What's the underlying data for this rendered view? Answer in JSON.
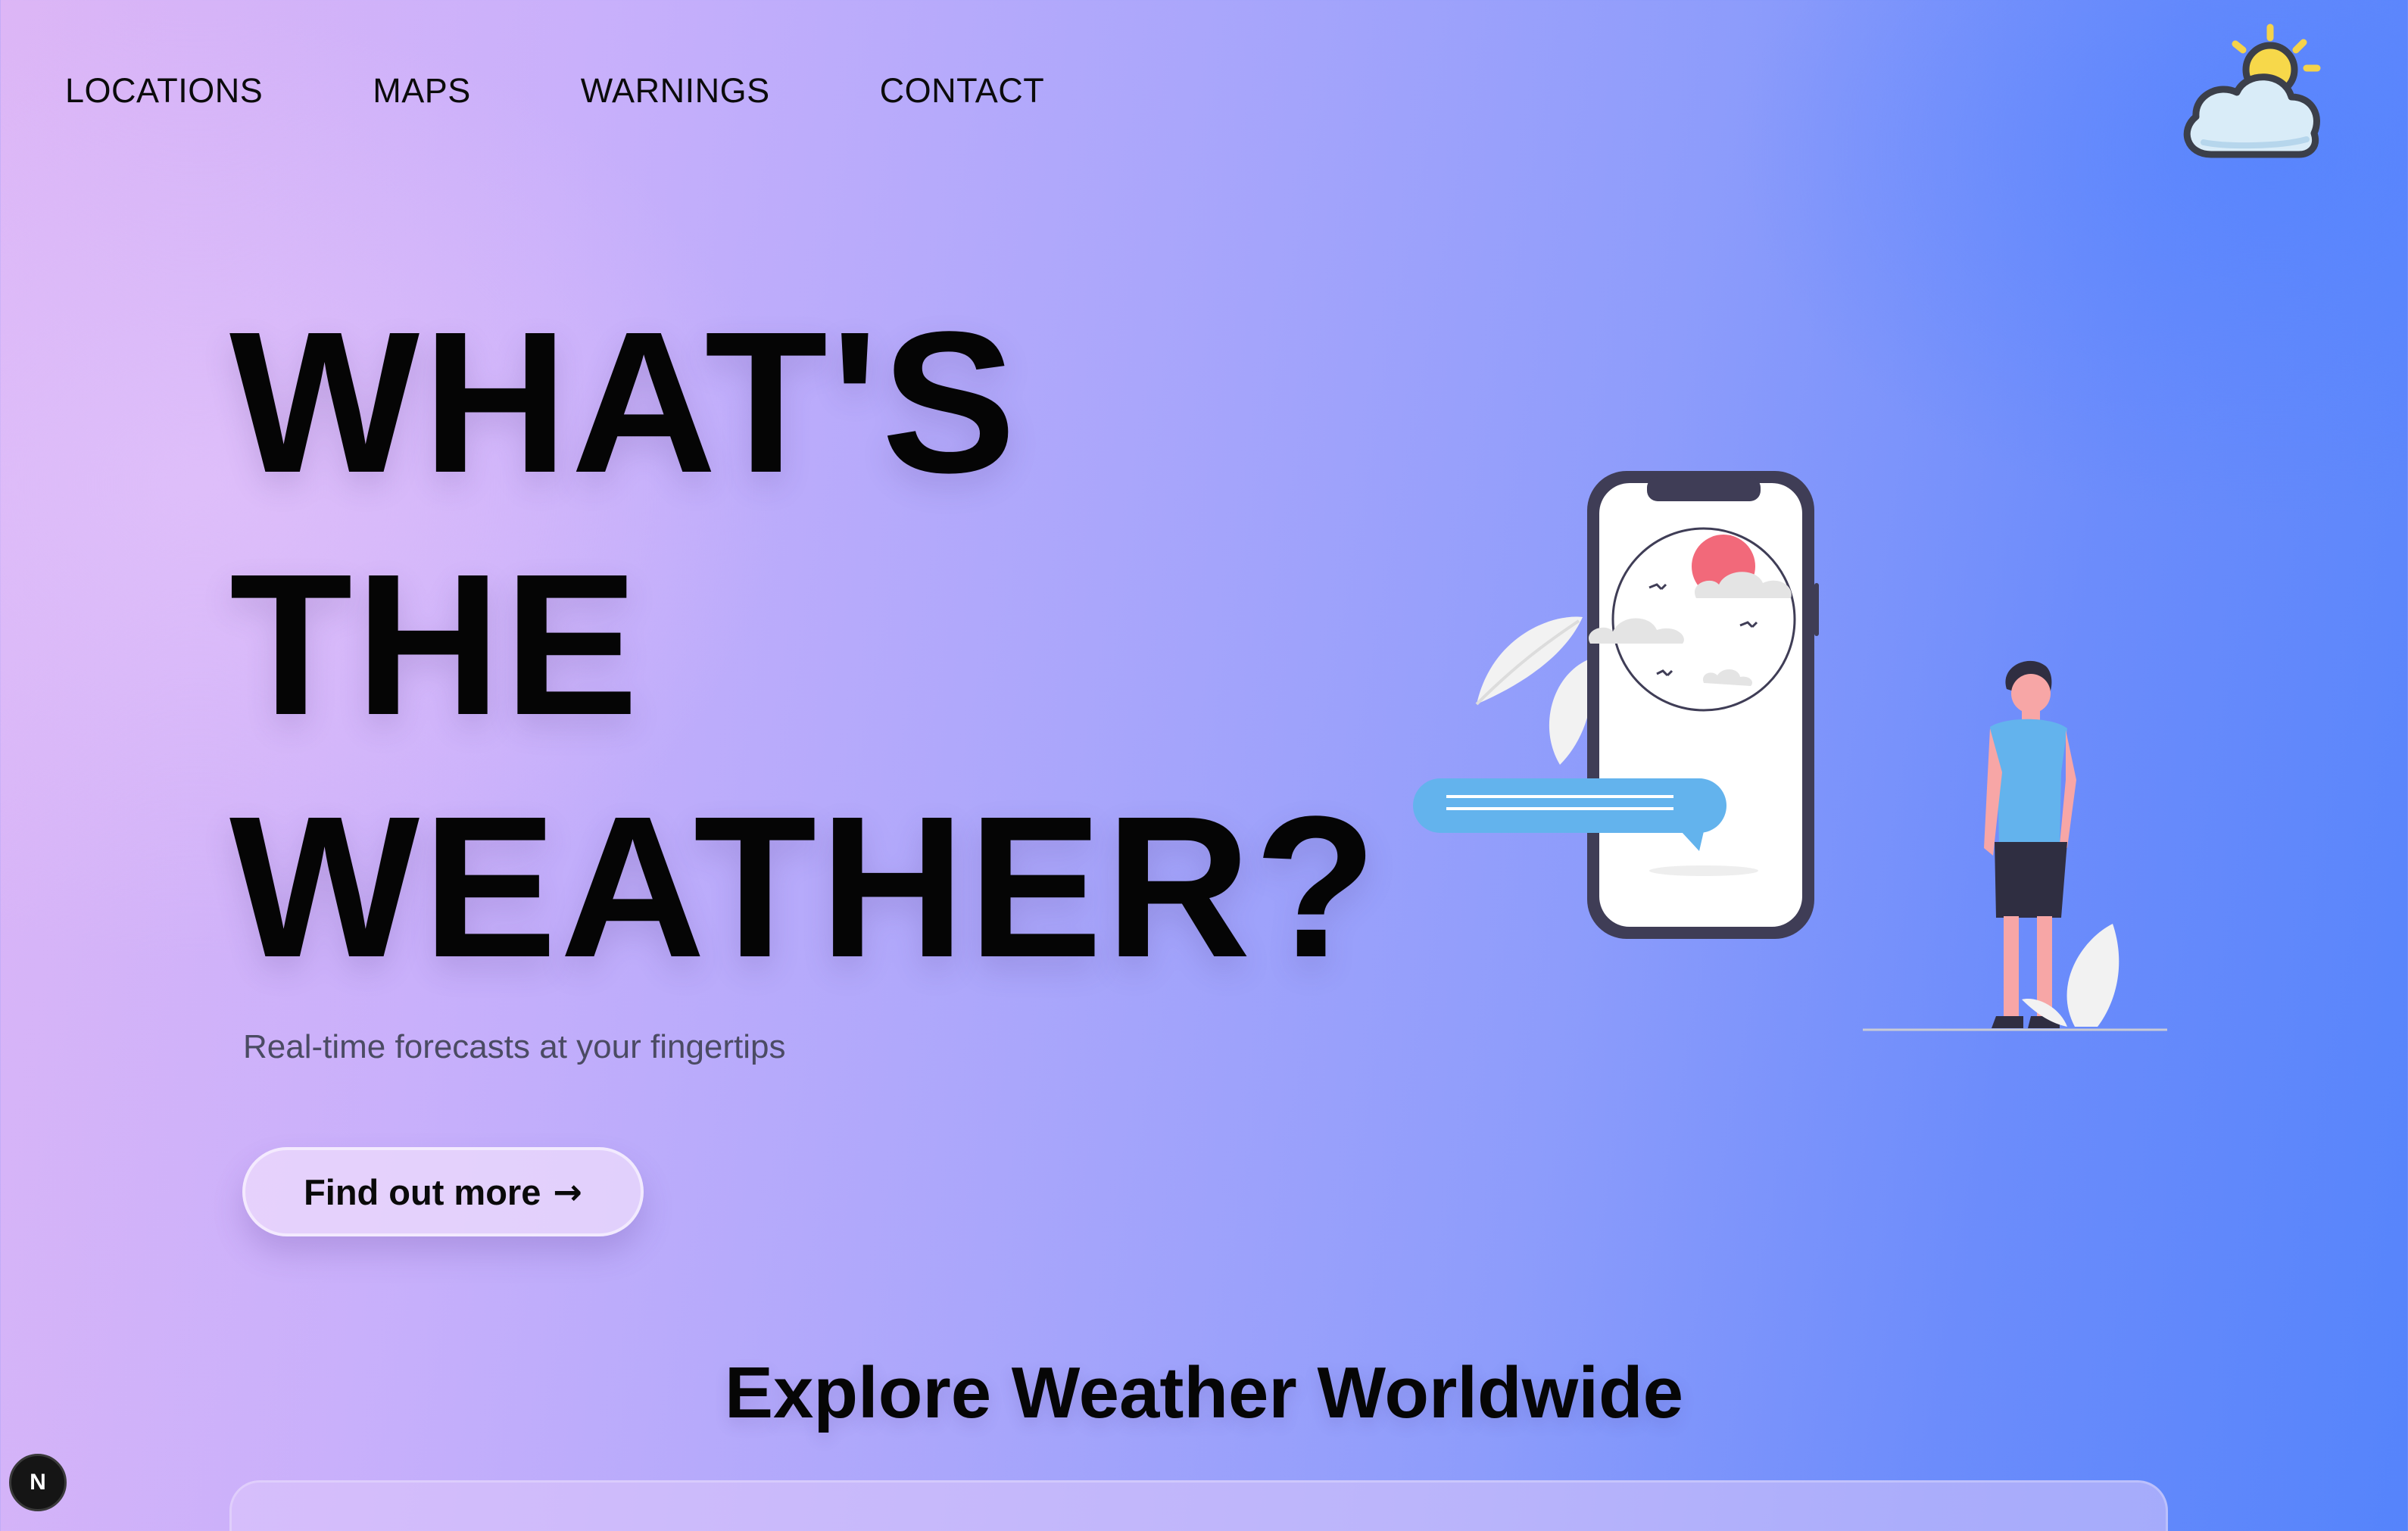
{
  "nav": {
    "items": [
      {
        "label": "LOCATIONS"
      },
      {
        "label": "MAPS"
      },
      {
        "label": "WARNINGS"
      },
      {
        "label": "CONTACT"
      }
    ]
  },
  "logo": {
    "icon": "weather-sun-cloud-icon"
  },
  "hero": {
    "title_lines": [
      "WHAT'S",
      "THE",
      "WEATHER?"
    ],
    "subtitle": "Real-time forecasts at your fingertips",
    "cta_label": "Find out more",
    "cta_icon": "→"
  },
  "section": {
    "title": "Explore Weather Worldwide"
  },
  "dev_badge": {
    "label": "N"
  },
  "colors": {
    "accent_blue": "#63b3ed",
    "sun_red": "#f2697a",
    "phone_frame": "#3f3d56",
    "sun_yellow": "#f7d84a"
  }
}
